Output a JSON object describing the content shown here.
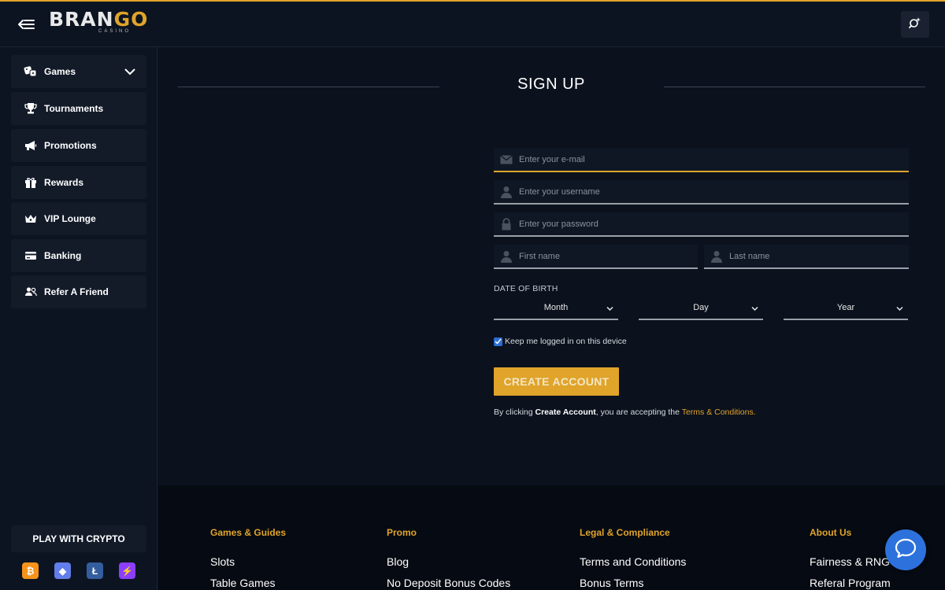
{
  "brand": {
    "name_part1": "BRAN",
    "name_part2": "GO",
    "subtitle": "CASINO"
  },
  "sidebar": {
    "items": [
      {
        "label": "Games",
        "icon": "dice-icon"
      },
      {
        "label": "Tournaments",
        "icon": "trophy-icon"
      },
      {
        "label": "Promotions",
        "icon": "megaphone-icon"
      },
      {
        "label": "Rewards",
        "icon": "gift-icon"
      },
      {
        "label": "VIP Lounge",
        "icon": "crown-icon"
      },
      {
        "label": "Banking",
        "icon": "card-icon"
      },
      {
        "label": "Refer A Friend",
        "icon": "users-icon"
      }
    ],
    "crypto_label": "PLAY WITH CRYPTO",
    "coins": [
      {
        "symbol": "₿",
        "color": "#f7931a"
      },
      {
        "symbol": "◆",
        "color": "#627eea"
      },
      {
        "symbol": "Ł",
        "color": "#345d9d"
      },
      {
        "symbol": "⚡",
        "color": "#8a3ffc"
      }
    ]
  },
  "signup": {
    "title": "SIGN UP",
    "email_placeholder": "Enter your e-mail",
    "username_placeholder": "Enter your username",
    "password_placeholder": "Enter your password",
    "firstname_placeholder": "First name",
    "lastname_placeholder": "Last name",
    "dob_label": "DATE OF BIRTH",
    "month": "Month",
    "day": "Day",
    "year": "Year",
    "keep_logged": "Keep me logged in on this device",
    "create_button": "CREATE ACCOUNT",
    "terms_prefix": "By clicking ",
    "terms_bold": "Create Account",
    "terms_middle": ", you are accepting the ",
    "terms_link": "Terms & Conditions."
  },
  "footer": {
    "columns": [
      {
        "heading": "Games & Guides",
        "links": [
          "Slots",
          "Table Games"
        ]
      },
      {
        "heading": "Promo",
        "links": [
          "Blog",
          "No Deposit Bonus Codes"
        ]
      },
      {
        "heading": "Legal & Compliance",
        "links": [
          "Terms and Conditions",
          "Bonus Terms"
        ]
      },
      {
        "heading": "About Us",
        "links": [
          "Fairness & RNG",
          "Referal Program"
        ]
      }
    ]
  },
  "colors": {
    "accent": "#e0a42a",
    "background": "#0b111d",
    "panel": "#131b29",
    "chat": "#2d72dc"
  }
}
